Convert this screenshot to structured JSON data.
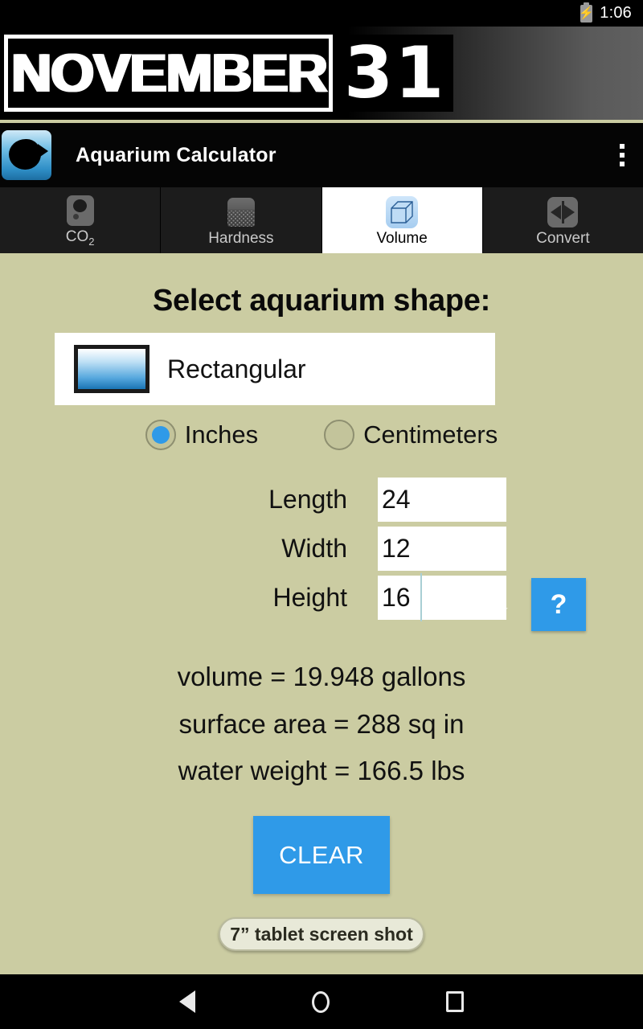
{
  "status_bar": {
    "time": "1:06",
    "battery_icon": "battery-charging-icon"
  },
  "banner": {
    "word": "NOVEMBER",
    "number": "31"
  },
  "app_bar": {
    "title": "Aquarium Calculator",
    "app_icon": "fish-icon",
    "overflow_icon": "overflow-menu-icon"
  },
  "tabs": [
    {
      "label": "CO",
      "sub": "2",
      "icon": "co2-icon",
      "active": false
    },
    {
      "label": "Hardness",
      "sub": "",
      "icon": "hardness-icon",
      "active": false
    },
    {
      "label": "Volume",
      "sub": "",
      "icon": "volume-cube-icon",
      "active": true
    },
    {
      "label": "Convert",
      "sub": "",
      "icon": "convert-arrows-icon",
      "active": false
    }
  ],
  "main": {
    "headline": "Select aquarium shape:",
    "shape_spinner": {
      "selected": "Rectangular",
      "swatch_icon": "rectangular-tank-icon",
      "dropdown_icon": "chevron-down-icon"
    },
    "help_button_label": "?",
    "units": [
      {
        "label": "Inches",
        "selected": true
      },
      {
        "label": "Centimeters",
        "selected": false
      }
    ],
    "fields": [
      {
        "label": "Length",
        "value": "24",
        "caret": false
      },
      {
        "label": "Width",
        "value": "12",
        "caret": false
      },
      {
        "label": "Height",
        "value": "16",
        "caret": true
      }
    ],
    "results": [
      "volume = 19.948 gallons",
      "surface area = 288 sq in",
      "water weight = 166.5 lbs"
    ],
    "clear_button_label": "CLEAR",
    "badge_label": "7” tablet screen shot"
  },
  "nav_bar": {
    "back_icon": "back-triangle-icon",
    "home_icon": "home-circle-icon",
    "recents_icon": "recents-square-icon"
  },
  "colors": {
    "background": "#cbcca2",
    "accent_blue": "#2f9ae8",
    "bar_black": "#000000",
    "tab_inactive": "#1c1c1c"
  }
}
